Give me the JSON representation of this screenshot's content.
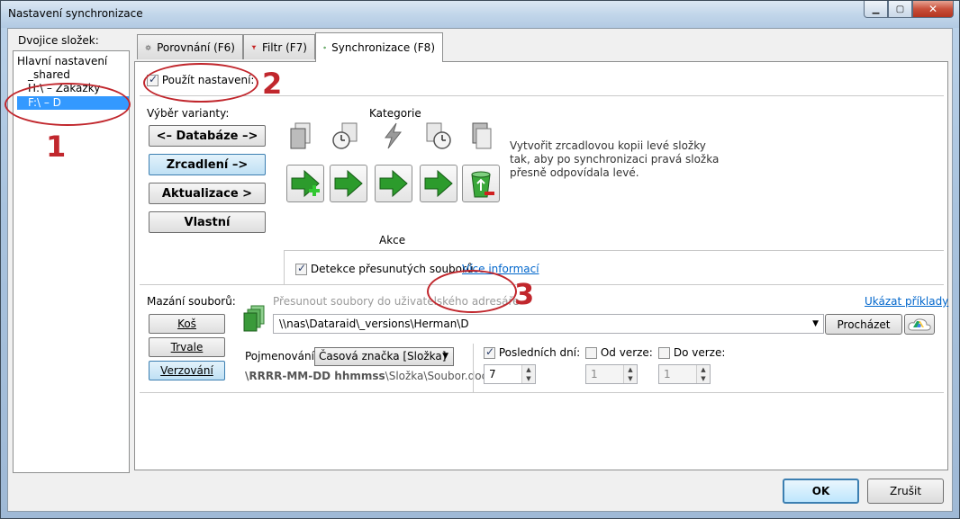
{
  "window": {
    "title": "Nastavení synchronizace"
  },
  "left": {
    "label": "Dvojice složek:",
    "items": [
      "Hlavní nastavení",
      "_shared",
      "H:\\ – Zakazky",
      "F:\\ – D"
    ]
  },
  "tabs": [
    {
      "label": "Porovnání (F6)",
      "icon": "gear-icon"
    },
    {
      "label": "Filtr (F7)",
      "icon": "filter-icon"
    },
    {
      "label": "Synchronizace (F8)",
      "icon": "gear-green-icon"
    }
  ],
  "settings": {
    "use_label": "Použít nastavení:",
    "use_checked": true
  },
  "variant": {
    "label": "Výběr varianty:",
    "buttons": [
      "<– Databáze –>",
      "Zrcadlení –>",
      "Aktualizace >",
      "Vlastní"
    ],
    "active": 1
  },
  "categories": {
    "label": "Kategorie",
    "actions_label": "Akce"
  },
  "description": "Vytvořit zrcadlovou kopii levé složky tak, aby po synchronizaci pravá složka přesně odpovídala levé.",
  "detect": {
    "label": "Detekce přesunutých souborů",
    "checked": true,
    "more_link": "Více informací"
  },
  "deletion": {
    "label": "Mazání souborů:",
    "buttons": [
      "Koš",
      "Trvale",
      "Verzování"
    ],
    "active": 2,
    "move_label": "Přesunout soubory do uživatelského adresáře",
    "examples_link": "Ukázat příklady",
    "path": "\\\\nas\\Dataraid\\_versions\\Herman\\D",
    "browse": "Procházet",
    "naming_label": "Pojmenování:",
    "naming_value": "Časová značka [Složka]",
    "pattern_bold": "\\RRRR-MM-DD hhmmss",
    "pattern_rest": "\\Složka\\Soubor.doc",
    "last_days": {
      "label": "Posledních dní:",
      "checked": true,
      "value": "7"
    },
    "from_version": {
      "label": "Od verze:",
      "checked": false,
      "value": "1"
    },
    "to_version": {
      "label": "Do verze:",
      "checked": false,
      "value": "1"
    }
  },
  "footer": {
    "ok": "OK",
    "cancel": "Zrušit"
  },
  "annotations": [
    "1",
    "2",
    "3"
  ]
}
